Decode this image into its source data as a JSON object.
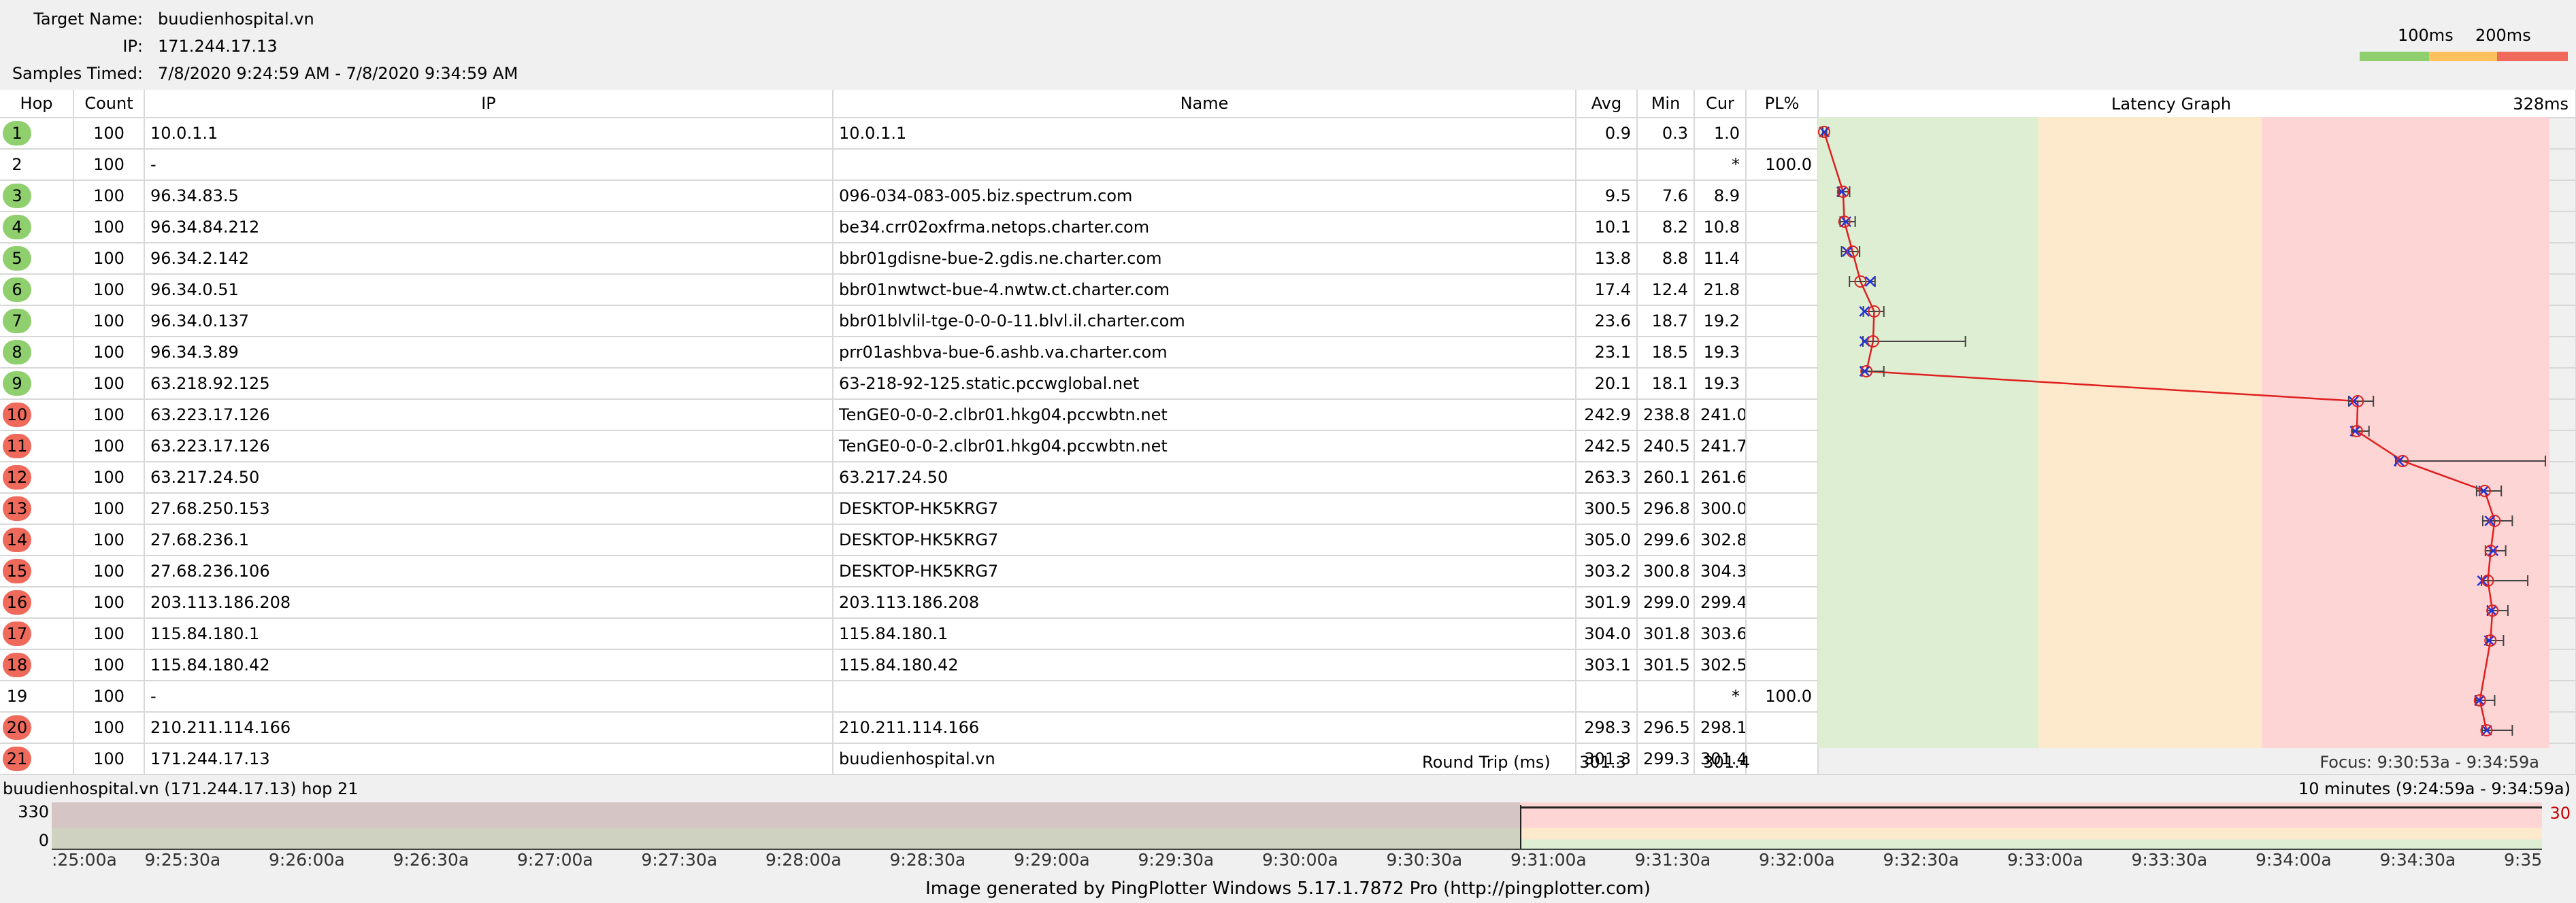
{
  "header": {
    "target_label": "Target Name:",
    "target_value": "buudienhospital.vn",
    "ip_label": "IP:",
    "ip_value": "171.244.17.13",
    "samples_label": "Samples Timed:",
    "samples_value": "7/8/2020 9:24:59 AM - 7/8/2020 9:34:59 AM",
    "legend_100": "100ms",
    "legend_200": "200ms"
  },
  "columns": {
    "hop": "Hop",
    "count": "Count",
    "ip": "IP",
    "name": "Name",
    "avg": "Avg",
    "min": "Min",
    "cur": "Cur",
    "pl": "PL%",
    "graph": "Latency Graph",
    "graph_max": "328ms"
  },
  "graph_scale_max_ms": 328,
  "hops": [
    {
      "hop": "1",
      "count": "100",
      "ip": "10.0.1.1",
      "name": "10.0.1.1",
      "avg": "0.9",
      "min": "0.3",
      "cur": "1.0",
      "pl": "",
      "color": "green",
      "a": 0.9,
      "mn": 0.3,
      "cu": 1.0,
      "mx": 2.0
    },
    {
      "hop": "2",
      "count": "100",
      "ip": "-",
      "name": "",
      "avg": "",
      "min": "",
      "cur": "*",
      "pl": "100.0",
      "color": "none"
    },
    {
      "hop": "3",
      "count": "100",
      "ip": "96.34.83.5",
      "name": "096-034-083-005.biz.spectrum.com",
      "avg": "9.5",
      "min": "7.6",
      "cur": "8.9",
      "pl": "",
      "color": "green",
      "a": 9.5,
      "mn": 7.6,
      "cu": 8.9,
      "mx": 12.5
    },
    {
      "hop": "4",
      "count": "100",
      "ip": "96.34.84.212",
      "name": "be34.crr02oxfrma.netops.charter.com",
      "avg": "10.1",
      "min": "8.2",
      "cur": "10.8",
      "pl": "",
      "color": "green",
      "a": 10.1,
      "mn": 8.2,
      "cu": 10.8,
      "mx": 15
    },
    {
      "hop": "5",
      "count": "100",
      "ip": "96.34.2.142",
      "name": "bbr01gdisne-bue-2.gdis.ne.charter.com",
      "avg": "13.8",
      "min": "8.8",
      "cur": "11.4",
      "pl": "",
      "color": "green",
      "a": 13.8,
      "mn": 8.8,
      "cu": 11.4,
      "mx": 17
    },
    {
      "hop": "6",
      "count": "100",
      "ip": "96.34.0.51",
      "name": "bbr01nwtwct-bue-4.nwtw.ct.charter.com",
      "avg": "17.4",
      "min": "12.4",
      "cur": "21.8",
      "pl": "",
      "color": "green",
      "a": 17.4,
      "mn": 12.4,
      "cu": 21.8,
      "mx": 24
    },
    {
      "hop": "7",
      "count": "100",
      "ip": "96.34.0.137",
      "name": "bbr01blvlil-tge-0-0-0-11.blvl.il.charter.com",
      "avg": "23.6",
      "min": "18.7",
      "cur": "19.2",
      "pl": "",
      "color": "green",
      "a": 23.6,
      "mn": 18.7,
      "cu": 19.2,
      "mx": 28
    },
    {
      "hop": "8",
      "count": "100",
      "ip": "96.34.3.89",
      "name": "prr01ashbva-bue-6.ashb.va.charter.com",
      "avg": "23.1",
      "min": "18.5",
      "cur": "19.3",
      "pl": "",
      "color": "green",
      "a": 23.1,
      "mn": 18.5,
      "cu": 19.3,
      "mx": 65
    },
    {
      "hop": "9",
      "count": "100",
      "ip": "63.218.92.125",
      "name": "63-218-92-125.static.pccwglobal.net",
      "avg": "20.1",
      "min": "18.1",
      "cur": "19.3",
      "pl": "",
      "color": "green",
      "a": 20.1,
      "mn": 18.1,
      "cu": 19.3,
      "mx": 28
    },
    {
      "hop": "10",
      "count": "100",
      "ip": "63.223.17.126",
      "name": "TenGE0-0-0-2.clbr01.hkg04.pccwbtn.net",
      "avg": "242.9",
      "min": "238.8",
      "cur": "241.0",
      "pl": "",
      "color": "red",
      "a": 242.9,
      "mn": 238.8,
      "cu": 241.0,
      "mx": 250
    },
    {
      "hop": "11",
      "count": "100",
      "ip": "63.223.17.126",
      "name": "TenGE0-0-0-2.clbr01.hkg04.pccwbtn.net",
      "avg": "242.5",
      "min": "240.5",
      "cur": "241.7",
      "pl": "",
      "color": "red",
      "a": 242.5,
      "mn": 240.5,
      "cu": 241.7,
      "mx": 248
    },
    {
      "hop": "12",
      "count": "100",
      "ip": "63.217.24.50",
      "name": "63.217.24.50",
      "avg": "263.3",
      "min": "260.1",
      "cur": "261.6",
      "pl": "",
      "color": "red",
      "a": 263.3,
      "mn": 260.1,
      "cu": 261.6,
      "mx": 328
    },
    {
      "hop": "13",
      "count": "100",
      "ip": "27.68.250.153",
      "name": "DESKTOP-HK5KRG7",
      "avg": "300.5",
      "min": "296.8",
      "cur": "300.0",
      "pl": "",
      "color": "red",
      "a": 300.5,
      "mn": 296.8,
      "cu": 300.0,
      "mx": 308
    },
    {
      "hop": "14",
      "count": "100",
      "ip": "27.68.236.1",
      "name": "DESKTOP-HK5KRG7",
      "avg": "305.0",
      "min": "299.6",
      "cur": "302.8",
      "pl": "",
      "color": "red",
      "a": 305.0,
      "mn": 299.6,
      "cu": 302.8,
      "mx": 313
    },
    {
      "hop": "15",
      "count": "100",
      "ip": "27.68.236.106",
      "name": "DESKTOP-HK5KRG7",
      "avg": "303.2",
      "min": "300.8",
      "cur": "304.3",
      "pl": "",
      "color": "red",
      "a": 303.2,
      "mn": 300.8,
      "cu": 304.3,
      "mx": 310
    },
    {
      "hop": "16",
      "count": "100",
      "ip": "203.113.186.208",
      "name": "203.113.186.208",
      "avg": "301.9",
      "min": "299.0",
      "cur": "299.4",
      "pl": "",
      "color": "red",
      "a": 301.9,
      "mn": 299.0,
      "cu": 299.4,
      "mx": 320
    },
    {
      "hop": "17",
      "count": "100",
      "ip": "115.84.180.1",
      "name": "115.84.180.1",
      "avg": "304.0",
      "min": "301.8",
      "cur": "303.6",
      "pl": "",
      "color": "red",
      "a": 304.0,
      "mn": 301.8,
      "cu": 303.6,
      "mx": 311
    },
    {
      "hop": "18",
      "count": "100",
      "ip": "115.84.180.42",
      "name": "115.84.180.42",
      "avg": "303.1",
      "min": "301.5",
      "cur": "302.5",
      "pl": "",
      "color": "red",
      "a": 303.1,
      "mn": 301.5,
      "cu": 302.5,
      "mx": 309
    },
    {
      "hop": "19",
      "count": "100",
      "ip": "-",
      "name": "",
      "avg": "",
      "min": "",
      "cur": "*",
      "pl": "100.0",
      "color": "none"
    },
    {
      "hop": "20",
      "count": "100",
      "ip": "210.211.114.166",
      "name": "210.211.114.166",
      "avg": "298.3",
      "min": "296.5",
      "cur": "298.1",
      "pl": "",
      "color": "red",
      "a": 298.3,
      "mn": 296.5,
      "cu": 298.1,
      "mx": 305
    },
    {
      "hop": "21",
      "count": "100",
      "ip": "171.244.17.13",
      "name": "buudienhospital.vn",
      "avg": "301.3",
      "min": "299.3",
      "cur": "301.4",
      "pl": "",
      "color": "red",
      "a": 301.3,
      "mn": 299.3,
      "cu": 301.4,
      "mx": 313
    }
  ],
  "roundtrip": {
    "label": "Round Trip (ms)",
    "avg": "301.3",
    "cur": "301.4",
    "focus": "Focus: 9:30:53a - 9:34:59a"
  },
  "history": {
    "title": "buudienhospital.vn (171.244.17.13) hop 21",
    "range": "10 minutes (9:24:59a - 9:34:59a)",
    "y_top": "330",
    "y_bottom": "0",
    "right_value": "30",
    "ticks": [
      ":25:00a",
      "9:25:30a",
      "9:26:00a",
      "9:26:30a",
      "9:27:00a",
      "9:27:30a",
      "9:28:00a",
      "9:28:30a",
      "9:29:00a",
      "9:29:30a",
      "9:30:00a",
      "9:30:30a",
      "9:31:00a",
      "9:31:30a",
      "9:32:00a",
      "9:32:30a",
      "9:33:00a",
      "9:33:30a",
      "9:34:00a",
      "9:34:30a",
      "9:35"
    ]
  },
  "footer": "Image generated by PingPlotter Windows 5.17.1.7872 Pro (http://pingplotter.com)",
  "colors": {
    "green": "#8fcf6e",
    "yellow": "#ffc15e",
    "red": "#f06a5c",
    "band_green": "#ddeed3",
    "band_yellow": "#fde9cc",
    "band_red": "#fdd5d5"
  }
}
